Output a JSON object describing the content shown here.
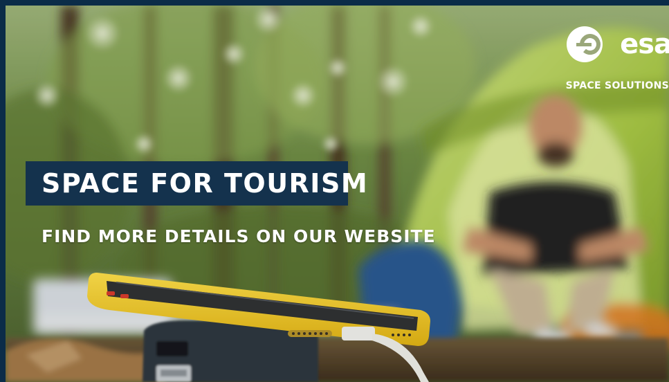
{
  "branding": {
    "logo_text": "esa",
    "subtitle": "SPACE SOLUTIONS",
    "logo_icon": "esa-logo-icon"
  },
  "headline": {
    "title": "SPACE FOR TOURISM",
    "subtitle": "FIND MORE DETAILS ON OUR WEBSITE"
  },
  "colors": {
    "frame": "#0b2c48",
    "title_box": "#14324d",
    "text": "#ffffff",
    "phone_case": "#f2c81e",
    "tent": "#b7d44a"
  }
}
